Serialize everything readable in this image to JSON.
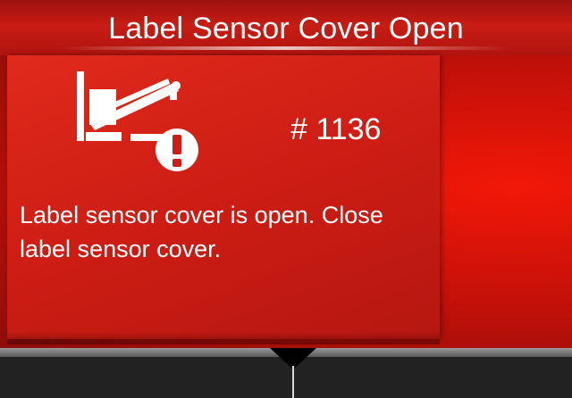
{
  "header": {
    "title": "Label Sensor Cover Open"
  },
  "error": {
    "icon": "label-sensor-cover-open-warning-icon",
    "code": "# 1136",
    "message": "Label sensor cover is open. Close label sensor cover."
  },
  "footer": {
    "icon": "down-arrow-icon"
  },
  "colors": {
    "header_red": "#c81d14",
    "panel_red": "#cd1d14",
    "footer_dark": "#222222",
    "text": "#ffffff"
  }
}
